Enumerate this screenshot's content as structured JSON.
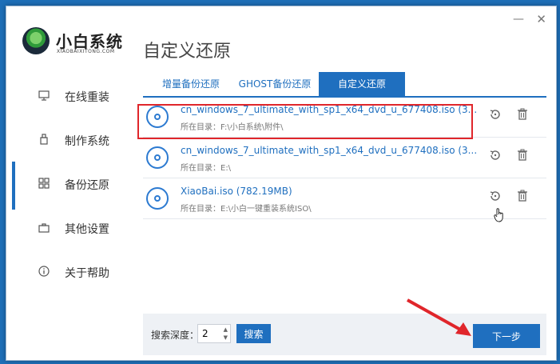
{
  "app": {
    "logo_name": "小白系统",
    "logo_sub": "XIAOBAIXITONG.COM"
  },
  "window_controls": {
    "minimize": "—",
    "close": "✕"
  },
  "sidebar": {
    "items": [
      {
        "label": "在线重装",
        "icon": "monitor-icon"
      },
      {
        "label": "制作系统",
        "icon": "usb-icon"
      },
      {
        "label": "备份还原",
        "icon": "backup-icon",
        "active": true
      },
      {
        "label": "其他设置",
        "icon": "briefcase-icon"
      },
      {
        "label": "关于帮助",
        "icon": "info-icon"
      }
    ]
  },
  "main": {
    "title": "自定义还原",
    "tabs": [
      {
        "label": "增量备份还原"
      },
      {
        "label": "GHOST备份还原"
      },
      {
        "label": "自定义还原",
        "active": true
      }
    ],
    "files": [
      {
        "name": "cn_windows_7_ultimate_with_sp1_x64_dvd_u_677408.iso (3...",
        "path": "所在目录：F:\\小白系统\\附件\\"
      },
      {
        "name": "cn_windows_7_ultimate_with_sp1_x64_dvd_u_677408.iso (3...",
        "path": "所在目录：E:\\"
      },
      {
        "name": "XiaoBai.iso (782.19MB)",
        "path": "所在目录：E:\\小白一键重装系统ISO\\"
      }
    ]
  },
  "bottom": {
    "depth_label": "搜索深度：",
    "depth_value": "2",
    "search_button": "搜索",
    "next_button": "下一步"
  },
  "colors": {
    "accent": "#1f6fbf",
    "highlight": "#e0262b"
  }
}
